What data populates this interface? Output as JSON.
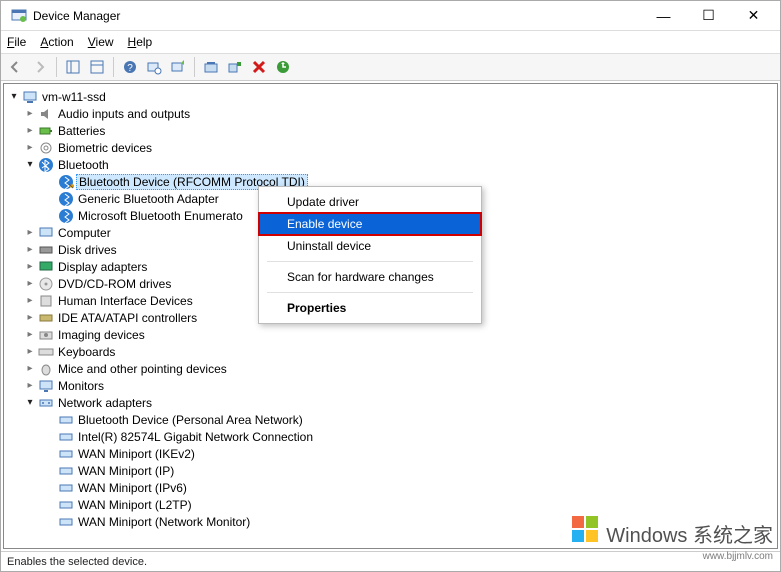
{
  "window": {
    "title": "Device Manager",
    "min": "—",
    "max": "☐",
    "close": "✕"
  },
  "menubar": {
    "file": "File",
    "action": "Action",
    "view": "View",
    "help": "Help"
  },
  "tree": {
    "root": "vm-w11-ssd",
    "audio": "Audio inputs and outputs",
    "batteries": "Batteries",
    "biometric": "Biometric devices",
    "bluetooth": "Bluetooth",
    "bt_rfcomm": "Bluetooth Device (RFCOMM Protocol TDI)",
    "bt_generic": "Generic Bluetooth Adapter",
    "bt_ms_enum": "Microsoft Bluetooth Enumerato",
    "computer": "Computer",
    "disk": "Disk drives",
    "display": "Display adapters",
    "dvd": "DVD/CD-ROM drives",
    "hid": "Human Interface Devices",
    "ide": "IDE ATA/ATAPI controllers",
    "imaging": "Imaging devices",
    "keyboards": "Keyboards",
    "mice": "Mice and other pointing devices",
    "monitors": "Monitors",
    "netadapters": "Network adapters",
    "net_btpan": "Bluetooth Device (Personal Area Network)",
    "net_intel": "Intel(R) 82574L Gigabit Network Connection",
    "net_wan_ikev2": "WAN Miniport (IKEv2)",
    "net_wan_ip": "WAN Miniport (IP)",
    "net_wan_ipv6": "WAN Miniport (IPv6)",
    "net_wan_l2tp": "WAN Miniport (L2TP)",
    "net_wan_netmon": "WAN Miniport (Network Monitor)"
  },
  "context_menu": {
    "update": "Update driver",
    "enable": "Enable device",
    "uninstall": "Uninstall device",
    "scan": "Scan for hardware changes",
    "properties": "Properties"
  },
  "statusbar": {
    "text": "Enables the selected device."
  },
  "watermark": {
    "main": "Windows 系统之家",
    "sub": "www.bjjmlv.com"
  }
}
